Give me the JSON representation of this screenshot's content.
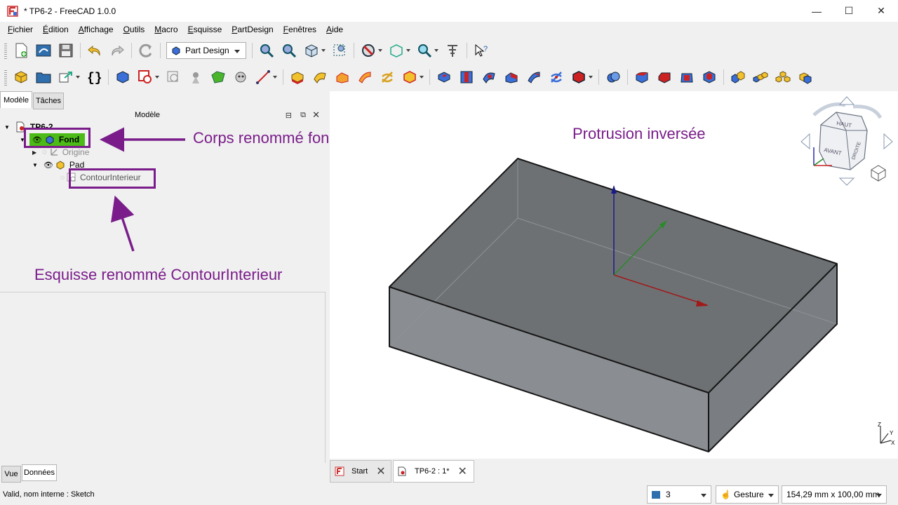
{
  "window": {
    "title": "* TP6-2 - FreeCAD 1.0.0",
    "minimize": "—",
    "maximize": "☐",
    "close": "✕"
  },
  "menu": [
    "Fichier",
    "Édition",
    "Affichage",
    "Outils",
    "Macro",
    "Esquisse",
    "PartDesign",
    "Fenêtres",
    "Aide"
  ],
  "toolbar": {
    "workbench": "Part Design"
  },
  "left_panel": {
    "tabs": [
      "Modèle",
      "Tâches"
    ],
    "title": "Modèle",
    "tree": {
      "root": "TP6-2",
      "body": "Fond",
      "origin": "Origine",
      "pad": "Pad",
      "sketch": "ContourInterieur"
    },
    "bottom_tabs": [
      "Vue",
      "Données"
    ]
  },
  "annotations": {
    "body_note": "Corps renommé fond",
    "sketch_note": "Esquisse renommé ContourInterieur",
    "protrusion_note": "Protrusion inversée",
    "color": "#7a1d8a"
  },
  "navcube": {
    "top": "HAUT",
    "front": "AVANT",
    "right": "DROITE"
  },
  "doc_tabs": [
    "Start",
    "TP6-2 : 1*"
  ],
  "status": {
    "message": "Valid, nom interne : Sketch",
    "layer": "3",
    "navigation": "Gesture",
    "dimensions": "154,29 mm x 100,00 mm"
  }
}
